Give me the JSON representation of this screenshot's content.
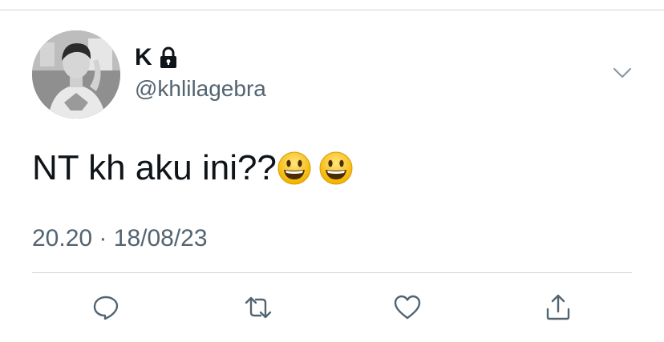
{
  "tweet": {
    "author": {
      "display_name": "K",
      "handle": "@khlilagebra",
      "protected_icon": "lock-icon"
    },
    "text": "NT kh aku ini??",
    "emojis": [
      "grinning-face-emoji",
      "grinning-face-emoji"
    ],
    "time": "20.20",
    "separator": "·",
    "date": "18/08/23"
  },
  "actions": [
    {
      "name": "reply-button",
      "icon": "reply-icon"
    },
    {
      "name": "retweet-button",
      "icon": "retweet-icon"
    },
    {
      "name": "like-button",
      "icon": "heart-icon"
    },
    {
      "name": "share-button",
      "icon": "share-icon"
    }
  ],
  "colors": {
    "text_primary": "#0f1419",
    "text_secondary": "#536471",
    "icon": "#536471",
    "divider": "#cfd4d8",
    "background": "#ffffff"
  }
}
